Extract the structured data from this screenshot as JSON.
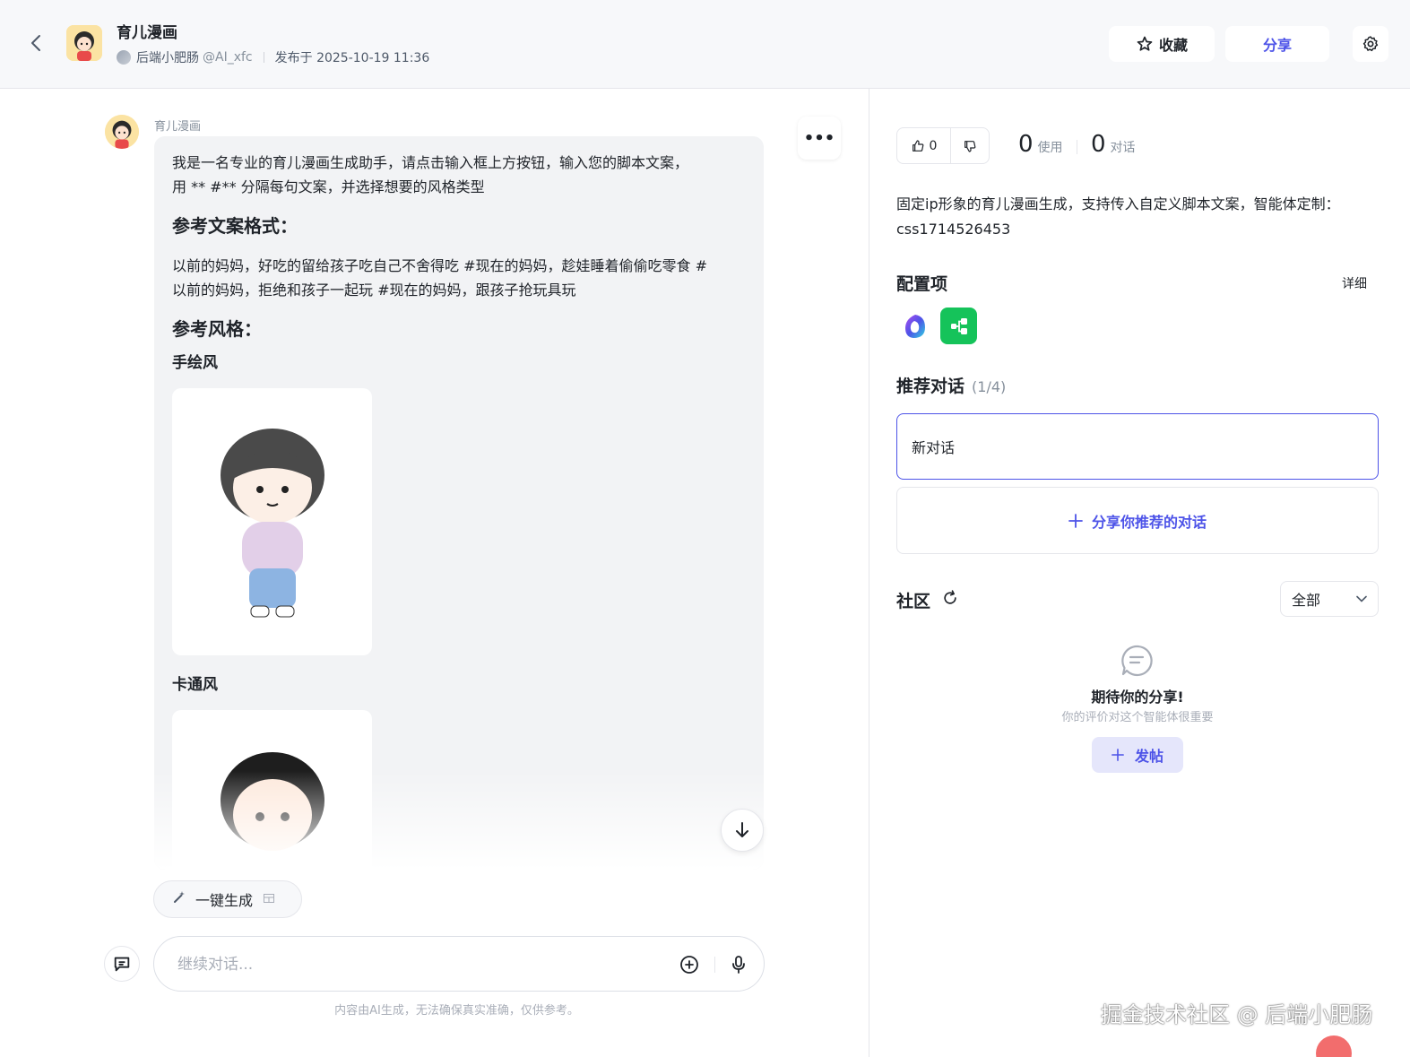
{
  "header": {
    "bot_name": "育儿漫画",
    "author_name": "后端小肥肠",
    "author_handle": "@AI_xfc",
    "published": "发布于 2025-10-19 11:36",
    "fav_label": "收藏",
    "share_label": "分享"
  },
  "chat": {
    "bot_name": "育儿漫画",
    "intro_line1": "我是一名专业的育儿漫画生成助手，请点击输入框上方按钮，输入您的脚本文案，",
    "intro_line2": "用 ** #** 分隔每句文案，并选择想要的风格类型",
    "heading_format": "参考文案格式：",
    "sample_line1": "以前的妈妈，好吃的留给孩子吃自己不舍得吃 #现在的妈妈，趁娃睡着偷偷吃零食 #",
    "sample_line2": "以前的妈妈，拒绝和孩子一起玩 #现在的妈妈，跟孩子抢玩具玩",
    "heading_style": "参考风格：",
    "style1": "手绘风",
    "style2": "卡通风",
    "quick_action": "一键生成",
    "input_placeholder": "继续对话...",
    "disclaimer": "内容由AI生成，无法确保真实准确，仅供参考。"
  },
  "side": {
    "likes": "0",
    "uses": "0",
    "uses_label": "使用",
    "dialogs": "0",
    "dialogs_label": "对话",
    "description": "固定ip形象的育儿漫画生成，支持传入自定义脚本文案，智能体定制：css1714526453",
    "config_title": "配置项",
    "detail_label": "详细",
    "rec_title": "推荐对话",
    "rec_count": "(1/4)",
    "rec_item": "新对话",
    "share_rec": "分享你推荐的对话",
    "community_title": "社区",
    "filter_value": "全部",
    "empty_title": "期待你的分享!",
    "empty_sub": "你的评价对这个智能体很重要",
    "post_label": "发帖"
  },
  "watermark": "掘金技术社区 @ 后端小肥肠",
  "colors": {
    "accent": "#4d53e8",
    "plugin_green": "#15c35a"
  }
}
